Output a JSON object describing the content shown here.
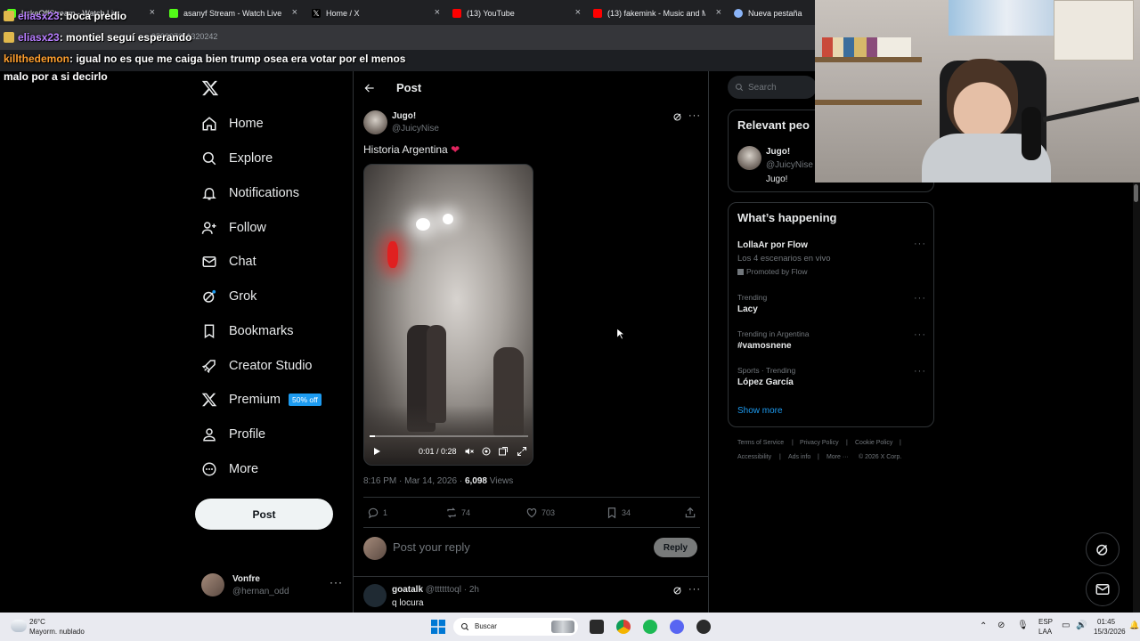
{
  "browser": {
    "tabs": [
      {
        "title": "LukeOffStream - Watch Live on",
        "color": "#53fc18"
      },
      {
        "title": "asanyf Stream - Watch Live on",
        "color": "#53fc18"
      },
      {
        "title": "Home / X",
        "color": "#ffffff"
      },
      {
        "title": "(13) YouTube",
        "color": "#ff0000"
      },
      {
        "title": "(13) fakemink - Music and Me",
        "color": "#ff0000"
      },
      {
        "title": "Nueva pestaña",
        "color": "#8ab4f8"
      }
    ],
    "url_fragment": "959007011320242"
  },
  "chat": [
    {
      "user": "eliasx23",
      "message": ": boca predio"
    },
    {
      "user": "eliasx23",
      "message": ": montiel seguí esperando"
    },
    {
      "user": "killthedemon",
      "message": ": igual no es que me caiga bien trump osea era votar por el menos"
    },
    {
      "user": "",
      "message": "malo por a si decirlo"
    }
  ],
  "sidebar": {
    "items": [
      {
        "label": "Home",
        "icon": "home-icon"
      },
      {
        "label": "Explore",
        "icon": "search-icon"
      },
      {
        "label": "Notifications",
        "icon": "bell-icon"
      },
      {
        "label": "Follow",
        "icon": "follow-icon"
      },
      {
        "label": "Chat",
        "icon": "mail-icon"
      },
      {
        "label": "Grok",
        "icon": "grok-icon"
      },
      {
        "label": "Bookmarks",
        "icon": "bookmark-icon"
      },
      {
        "label": "Creator Studio",
        "icon": "rocket-icon"
      },
      {
        "label": "Premium",
        "icon": "x-icon"
      },
      {
        "label": "Profile",
        "icon": "person-icon"
      },
      {
        "label": "More",
        "icon": "more-circle-icon"
      }
    ],
    "premium_badge": "50% off",
    "post_button": "Post",
    "account": {
      "name": "Vonfre",
      "handle": "@hernan_odd"
    }
  },
  "post": {
    "header_title": "Post",
    "author_name": "Jugo!",
    "author_handle": "@JuicyNise",
    "text": "Historia Argentina",
    "video_time": "0:01 / 0:28",
    "video_progress": 0.036,
    "timestamp": "8:16 PM · Mar 14, 2026 ·",
    "views_count": "6,098",
    "views_label": "Views",
    "replies": "1",
    "reposts": "74",
    "likes": "703",
    "bookmarks": "34",
    "reply_placeholder": "Post your reply",
    "reply_button": "Reply"
  },
  "reply": {
    "author": "goatalk",
    "handle_time": "@ttttttoql · 2h",
    "text": "q locura"
  },
  "right": {
    "search_placeholder": "Search",
    "relevant_title": "Relevant peo",
    "relevant_name": "Jugo!",
    "relevant_handle": "@JuicyNise",
    "relevant_bio": "Jugo!",
    "happening_title": "What’s happening",
    "trends": [
      {
        "context": "",
        "title": "LollaAr por Flow",
        "sub": "Los 4 escenarios en vivo",
        "promo": "Promoted by Flow"
      },
      {
        "context": "Trending",
        "title": "Lacy"
      },
      {
        "context": "Trending in Argentina",
        "title": "#vamosnene"
      },
      {
        "context": "Sports · Trending",
        "title": "López García"
      }
    ],
    "show_more": "Show more",
    "footer": [
      "Terms of Service",
      "|",
      "Privacy Policy",
      "|",
      "Cookie Policy",
      "|",
      "Accessibility",
      "|",
      "Ads info",
      "|",
      "More ···",
      "© 2026 X Corp."
    ]
  },
  "taskbar": {
    "weather_temp": "26°C",
    "weather_desc": "Mayorm. nublado",
    "search_label": "Buscar",
    "lang_top": "ESP",
    "lang_bottom": "LAA",
    "time": "01:45",
    "date": "15/3/2026"
  }
}
